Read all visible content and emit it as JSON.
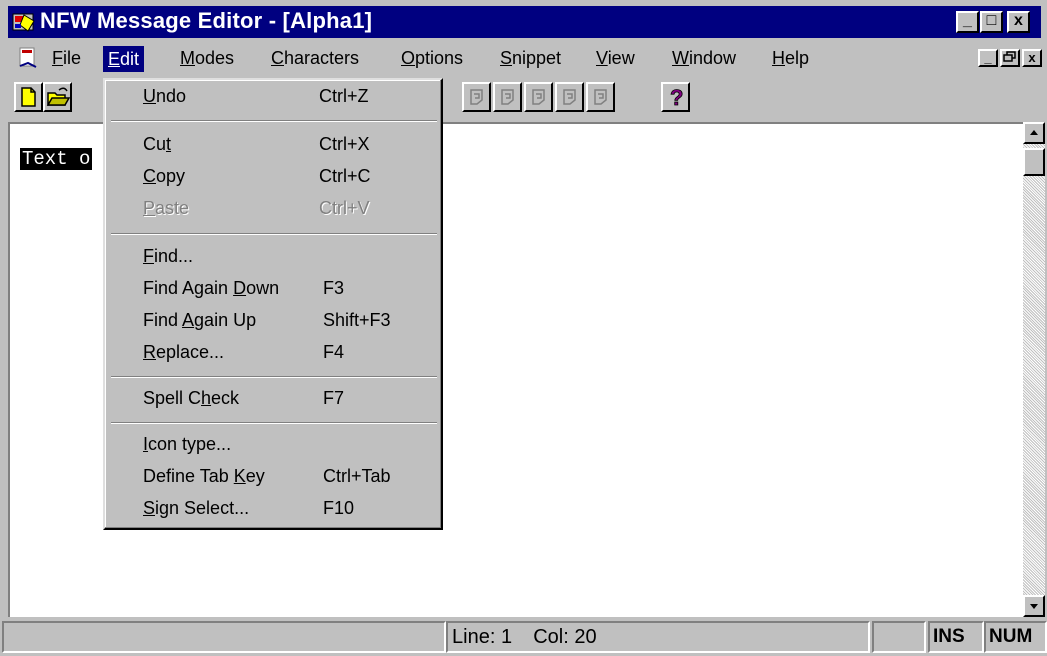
{
  "window": {
    "title": "NFW Message Editor - [Alpha1]",
    "controls": {
      "minimize": "_",
      "maximize": "□",
      "close": "x"
    },
    "mdi_controls": {
      "minimize": "_",
      "restore": "🗗",
      "close": "x"
    }
  },
  "menubar": {
    "items": [
      {
        "label": "File",
        "underline": "F"
      },
      {
        "label": "Edit",
        "underline": "E",
        "active": true
      },
      {
        "label": "Modes",
        "underline": "M"
      },
      {
        "label": "Characters",
        "underline": "C"
      },
      {
        "label": "Options",
        "underline": "O"
      },
      {
        "label": "Snippet",
        "underline": "S"
      },
      {
        "label": "View",
        "underline": "V"
      },
      {
        "label": "Window",
        "underline": "W"
      },
      {
        "label": "Help",
        "underline": "H"
      }
    ]
  },
  "toolbar": {
    "buttons": [
      "new-icon",
      "open-icon",
      "format-icon-1",
      "format-icon-2",
      "format-icon-3",
      "format-icon-4",
      "format-icon-5",
      "help-icon"
    ]
  },
  "edit_menu": {
    "items": [
      {
        "label": "Undo",
        "shortcut": "Ctrl+Z",
        "enabled": true
      },
      {
        "label": "Cut",
        "shortcut": "Ctrl+X",
        "enabled": true
      },
      {
        "label": "Copy",
        "shortcut": "Ctrl+C",
        "enabled": true
      },
      {
        "label": "Paste",
        "shortcut": "Ctrl+V",
        "enabled": false
      },
      {
        "label": "Find...",
        "shortcut": "",
        "enabled": true
      },
      {
        "label": "Find Again Down",
        "shortcut": "F3",
        "enabled": true
      },
      {
        "label": "Find Again Up",
        "shortcut": "Shift+F3",
        "enabled": true
      },
      {
        "label": "Replace...",
        "shortcut": "F4",
        "enabled": true
      },
      {
        "label": "Spell Check",
        "shortcut": "F7",
        "enabled": true
      },
      {
        "label": "Icon type...",
        "shortcut": "",
        "enabled": true
      },
      {
        "label": "Define Tab Key",
        "shortcut": "Ctrl+Tab",
        "enabled": true
      },
      {
        "label": "Sign Select...",
        "shortcut": "F10",
        "enabled": true
      }
    ]
  },
  "editor": {
    "text": "Text o"
  },
  "statusbar": {
    "line_label": "Line:",
    "line_value": "1",
    "col_label": "Col:",
    "col_value": "20",
    "ins": "INS",
    "num": "NUM"
  },
  "colors": {
    "titlebar": "#000080",
    "face": "#c0c0c0",
    "selection": "#000000"
  }
}
